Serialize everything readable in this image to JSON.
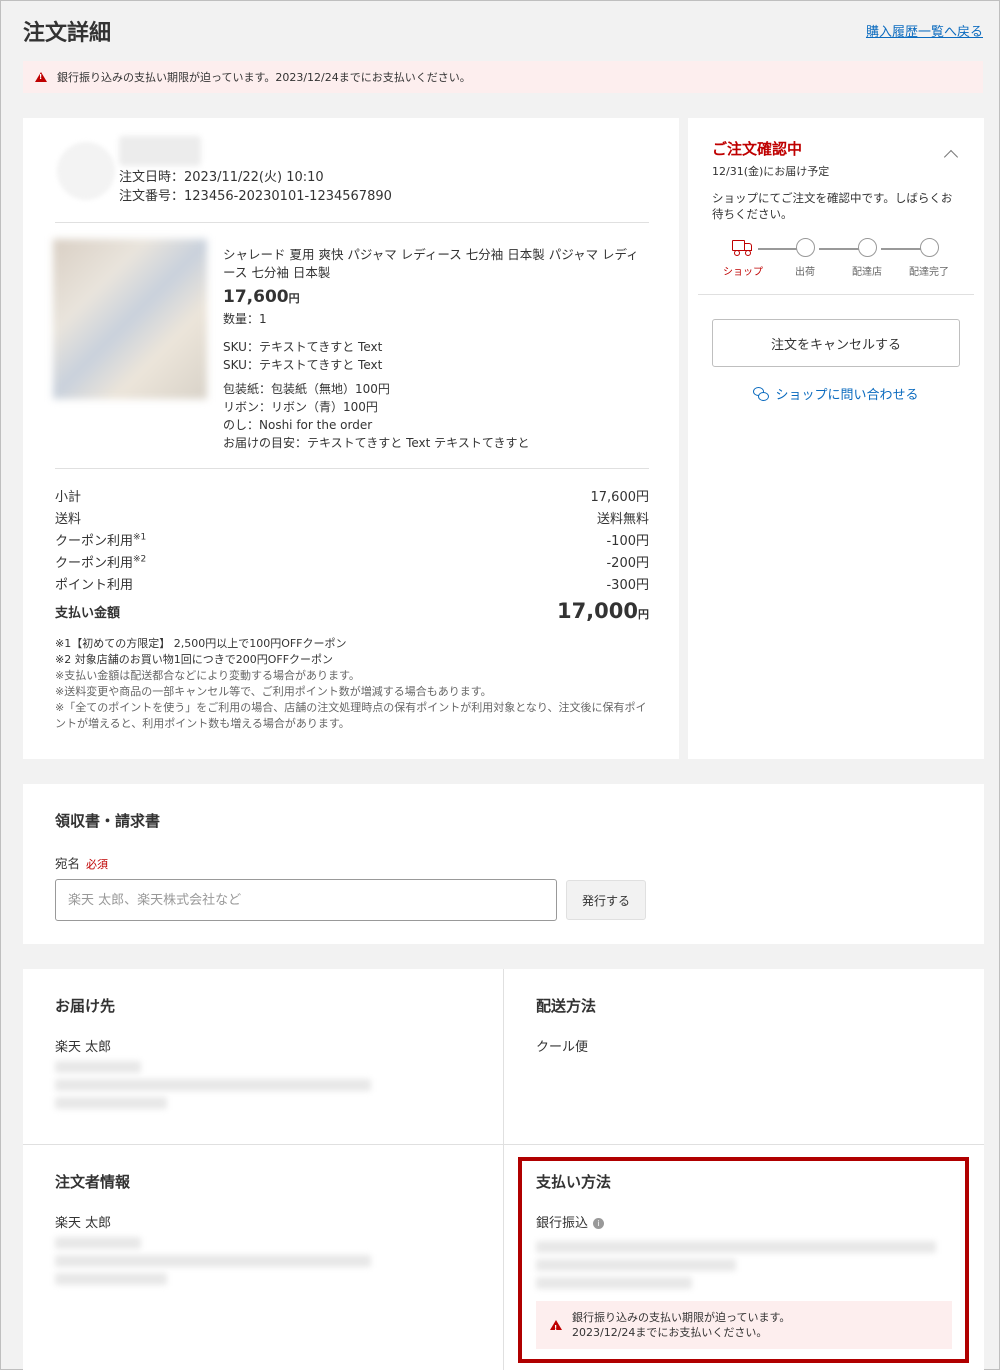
{
  "page": {
    "title": "注文詳細",
    "back_link": "購入履歴一覧へ戻る"
  },
  "top_alert": {
    "text": "銀行振り込みの支払い期限が迫っています。2023/12/24までにお支払いください。"
  },
  "order": {
    "date_line": "注文日時：2023/11/22(火) 10:10",
    "number_line": "注文番号：123456-20230101-1234567890",
    "product": {
      "name": "シャレード 夏用 爽快 パジャマ レディース 七分袖 日本製 パジャマ レディース 七分袖 日本製",
      "price": "17,600",
      "price_unit": "円",
      "quantity": "数量：1",
      "sku1": "SKU：テキストてきすと Text",
      "sku2": "SKU：テキストてきすと Text",
      "wrapping": "包装紙：包装紙（無地）100円",
      "ribbon": "リボン：リボン（青）100円",
      "noshi": "のし：Noshi for the order",
      "delivery_estimate": "お届けの目安：テキストてきすと Text テキストてきすと"
    },
    "totals": {
      "subtotal_label": "小計",
      "subtotal": "17,600円",
      "shipping_label": "送料",
      "shipping": "送料無料",
      "coupon1_label": "クーポン利用",
      "coupon1_mark": "※1",
      "coupon1": "-100円",
      "coupon2_label": "クーポン利用",
      "coupon2_mark": "※2",
      "coupon2": "-200円",
      "points_label": "ポイント利用",
      "points": "-300円",
      "total_label": "支払い金額",
      "total": "17,000",
      "total_unit": "円"
    },
    "notes": {
      "n1": "※1【初めての方限定】 2,500円以上で100円OFFクーポン",
      "n2": "※2 対象店舗のお買い物1回につきで200円OFFクーポン",
      "n3": "※支払い金額は配送都合などにより変動する場合があります。",
      "n4": "※送料変更や商品の一部キャンセル等で、ご利用ポイント数が増減する場合もあります。",
      "n5": "※「全てのポイントを使う」をご利用の場合、店舗の注文処理時点の保有ポイントが利用対象となり、注文後に保有ポイントが増えると、利用ポイント数も増える場合があります。"
    }
  },
  "status": {
    "title": "ご注文確認中",
    "delivery_date": "12/31(金)にお届け予定",
    "description": "ショップにてご注文を確認中です。しばらくお待ちください。",
    "steps": [
      "ショップ",
      "出荷",
      "配達店",
      "配達完了"
    ],
    "cancel_label": "注文をキャンセルする",
    "contact_label": "ショップに問い合わせる",
    "accent_color": "#bf0000"
  },
  "receipt": {
    "title": "領収書・請求書",
    "addressee_label": "宛名",
    "required_label": "必須",
    "input_placeholder": "楽天 太郎、楽天株式会社など",
    "input_value": "",
    "issue_label": "発行する"
  },
  "shipping_address": {
    "title": "お届け先",
    "name": "楽天 太郎"
  },
  "delivery_method": {
    "title": "配送方法",
    "value": "クール便"
  },
  "orderer": {
    "title": "注文者情報",
    "name": "楽天 太郎"
  },
  "payment": {
    "title": "支払い方法",
    "method": "銀行振込",
    "alert_line1": "銀行振り込みの支払い期限が迫っています。",
    "alert_line2": "2023/12/24までにお支払いください。"
  }
}
